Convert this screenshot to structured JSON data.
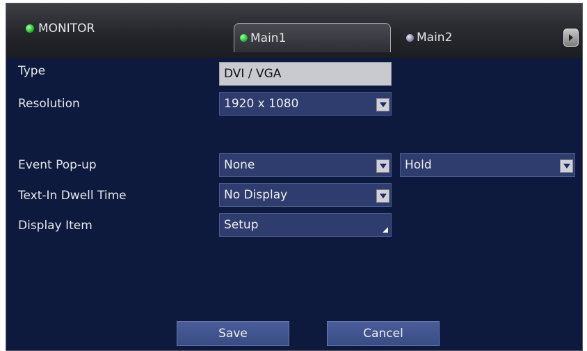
{
  "header": {
    "title": "MONITOR",
    "tabs": [
      {
        "label": "Main1",
        "active": true,
        "led_color": "#22cc33"
      },
      {
        "label": "Main2",
        "active": false,
        "led_color": "#8f93b5"
      }
    ],
    "next_icon": "chevron-right-icon"
  },
  "form": {
    "type": {
      "label": "Type",
      "value": "DVI / VGA"
    },
    "resolution": {
      "label": "Resolution",
      "value": "1920 x 1080"
    },
    "event_popup": {
      "label": "Event Pop-up",
      "value": "None",
      "second_value": "Hold"
    },
    "text_in_dwell": {
      "label": "Text-In Dwell Time",
      "value": "No Display"
    },
    "display_item": {
      "label": "Display Item",
      "value": "Setup"
    }
  },
  "buttons": {
    "save": "Save",
    "cancel": "Cancel"
  },
  "colors": {
    "background": "#0d1a3d",
    "field": "#2e3c6e",
    "button": "#3a4c85",
    "led_on": "#22cc33"
  }
}
